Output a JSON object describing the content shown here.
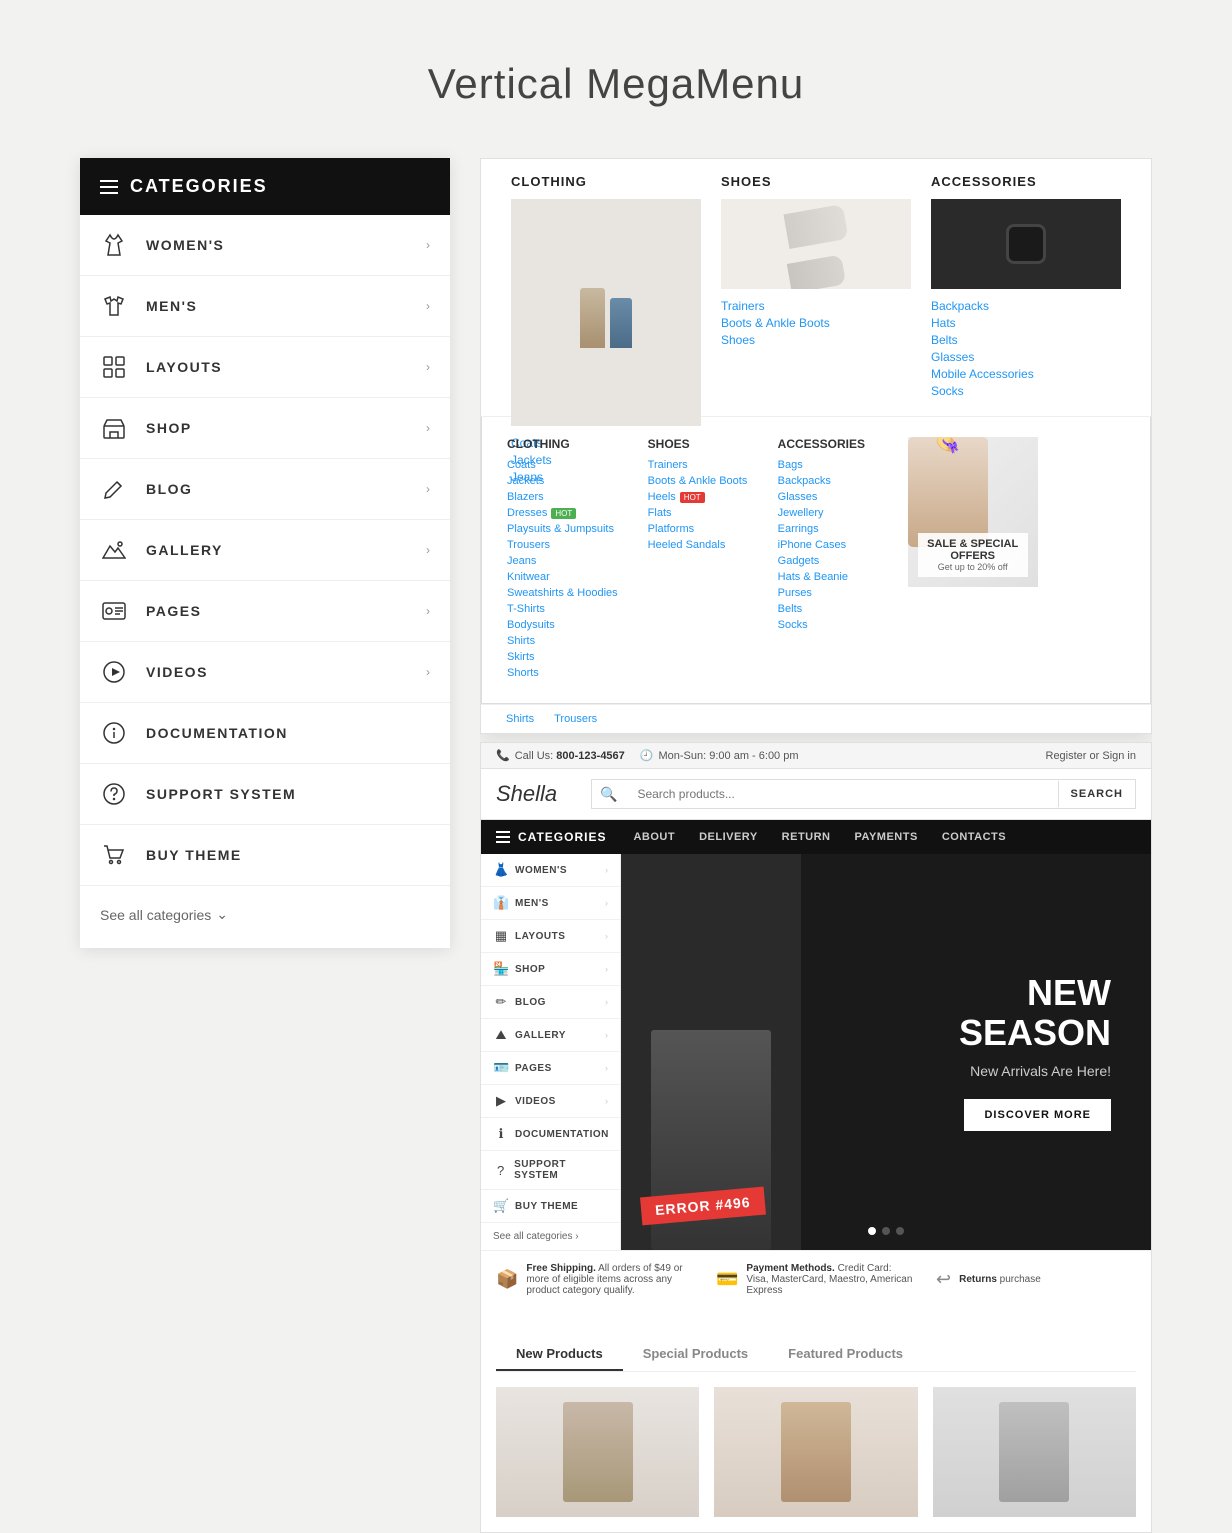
{
  "page": {
    "title": "Vertical MegaMenu"
  },
  "sidebar": {
    "header": "CATEGORIES",
    "items": [
      {
        "id": "womens",
        "label": "WOMEN'S",
        "icon": "dress",
        "hasArrow": true
      },
      {
        "id": "mens",
        "label": "MEN'S",
        "icon": "tshirt",
        "hasArrow": true
      },
      {
        "id": "layouts",
        "label": "LAYOUTS",
        "icon": "grid",
        "hasArrow": true
      },
      {
        "id": "shop",
        "label": "SHOP",
        "icon": "store",
        "hasArrow": true
      },
      {
        "id": "blog",
        "label": "BLOG",
        "icon": "pencil",
        "hasArrow": true
      },
      {
        "id": "gallery",
        "label": "GALLERY",
        "icon": "mountain",
        "hasArrow": true
      },
      {
        "id": "pages",
        "label": "PAGES",
        "icon": "id",
        "hasArrow": true
      },
      {
        "id": "videos",
        "label": "VIDEOS",
        "icon": "play",
        "hasArrow": true
      },
      {
        "id": "documentation",
        "label": "DOCUMENTATION",
        "icon": "info",
        "hasArrow": false
      },
      {
        "id": "support",
        "label": "SUPPORT SYSTEM",
        "icon": "question",
        "hasArrow": false
      },
      {
        "id": "buytheme",
        "label": "BUY THEME",
        "icon": "cart",
        "hasArrow": false
      }
    ],
    "seeAll": "See all categories"
  },
  "megaMenu": {
    "categories": [
      {
        "id": "clothing",
        "title": "CLOTHING",
        "links": [
          "Coats",
          "Jackets",
          "Jeans"
        ]
      },
      {
        "id": "shoes",
        "title": "SHOES",
        "links": [
          "Trainers",
          "Boots & Ankle Boots",
          "Shoes"
        ]
      },
      {
        "id": "accessories",
        "title": "ACCESSORIES",
        "links": [
          "Backpacks",
          "Hats",
          "Belts",
          "Glasses",
          "Mobile Accessories",
          "Socks"
        ]
      }
    ],
    "dropdownCols": {
      "clothing": {
        "title": "CLOTHING",
        "links": [
          "Coats",
          "Jackets",
          "Blazers",
          "Dresses",
          "Playsuits & Jumpsuits",
          "Trousers",
          "Jeans",
          "Knitwear",
          "Sweatshirts & Hoodies",
          "T-Shirts",
          "Bodysuits",
          "Shirts",
          "Skirts",
          "Shorts"
        ]
      },
      "shoes": {
        "title": "SHOES",
        "links": [
          "Trainers",
          "Boots & Ankle Boots",
          "Heels",
          "Flats",
          "Platforms",
          "Heeled Sandals"
        ]
      },
      "accessories": {
        "title": "ACCESSORIES",
        "links": [
          "Bags",
          "Backpacks",
          "Glasses",
          "Jewellery",
          "Earrings",
          "iPhone Cases",
          "Gadgets",
          "Hats & Beanie",
          "Purses",
          "Belts",
          "Socks"
        ]
      }
    },
    "dropdownFooter": [
      "Shirts",
      "Trousers"
    ],
    "saleBanner": {
      "title": "SALE & SPECIAL OFFERS",
      "subtitle": "Get up to 20% off"
    }
  },
  "store": {
    "topbar": {
      "callLabel": "Call Us:",
      "phone": "800-123-4567",
      "hours": "Mon-Sun: 9:00 am - 6:00 pm",
      "right": "Register or Sign in"
    },
    "logo": "Shella",
    "searchPlaceholder": "Search products...",
    "searchBtn": "SEARCH",
    "nav": {
      "categoriesLabel": "CATEGORIES",
      "links": [
        "ABOUT",
        "DELIVERY",
        "RETURN",
        "PAYMENTS",
        "CONTACTS"
      ]
    },
    "miniSidebar": {
      "items": [
        {
          "label": "WOMEN'S",
          "icon": "♀"
        },
        {
          "label": "MEN'S",
          "icon": "♂"
        },
        {
          "label": "LAYOUTS",
          "icon": "▦"
        },
        {
          "label": "SHOP",
          "icon": "🏪"
        },
        {
          "label": "BLOG",
          "icon": "✏"
        },
        {
          "label": "GALLERY",
          "icon": "⛰"
        },
        {
          "label": "PAGES",
          "icon": "🪪"
        },
        {
          "label": "VIDEOS",
          "icon": "▶"
        },
        {
          "label": "DOCUMENTATION",
          "icon": "ℹ"
        },
        {
          "label": "SUPPORT SYSTEM",
          "icon": "?"
        },
        {
          "label": "BUY THEME",
          "icon": "🛒"
        }
      ],
      "footer": "See all categories ›"
    },
    "hero": {
      "title": "NEW\nSEASON",
      "subtitle": "New Arrivals Are Here!",
      "btnLabel": "DISCOVER MORE",
      "errorBadge": "ERROR #496"
    },
    "infoBar": [
      {
        "icon": "📦",
        "strong": "Free Shipping.",
        "text": "All orders of $49 or more of eligible items across any product category qualify."
      },
      {
        "icon": "💳",
        "strong": "Payment Methods.",
        "text": "Credit Card: Visa, MasterCard, Maestro, American Express"
      },
      {
        "icon": "↩",
        "strong": "Returns",
        "text": "purchase"
      }
    ],
    "productTabs": [
      "New Products",
      "Special Products",
      "Featured Products"
    ],
    "activeProductTab": "New Products"
  }
}
